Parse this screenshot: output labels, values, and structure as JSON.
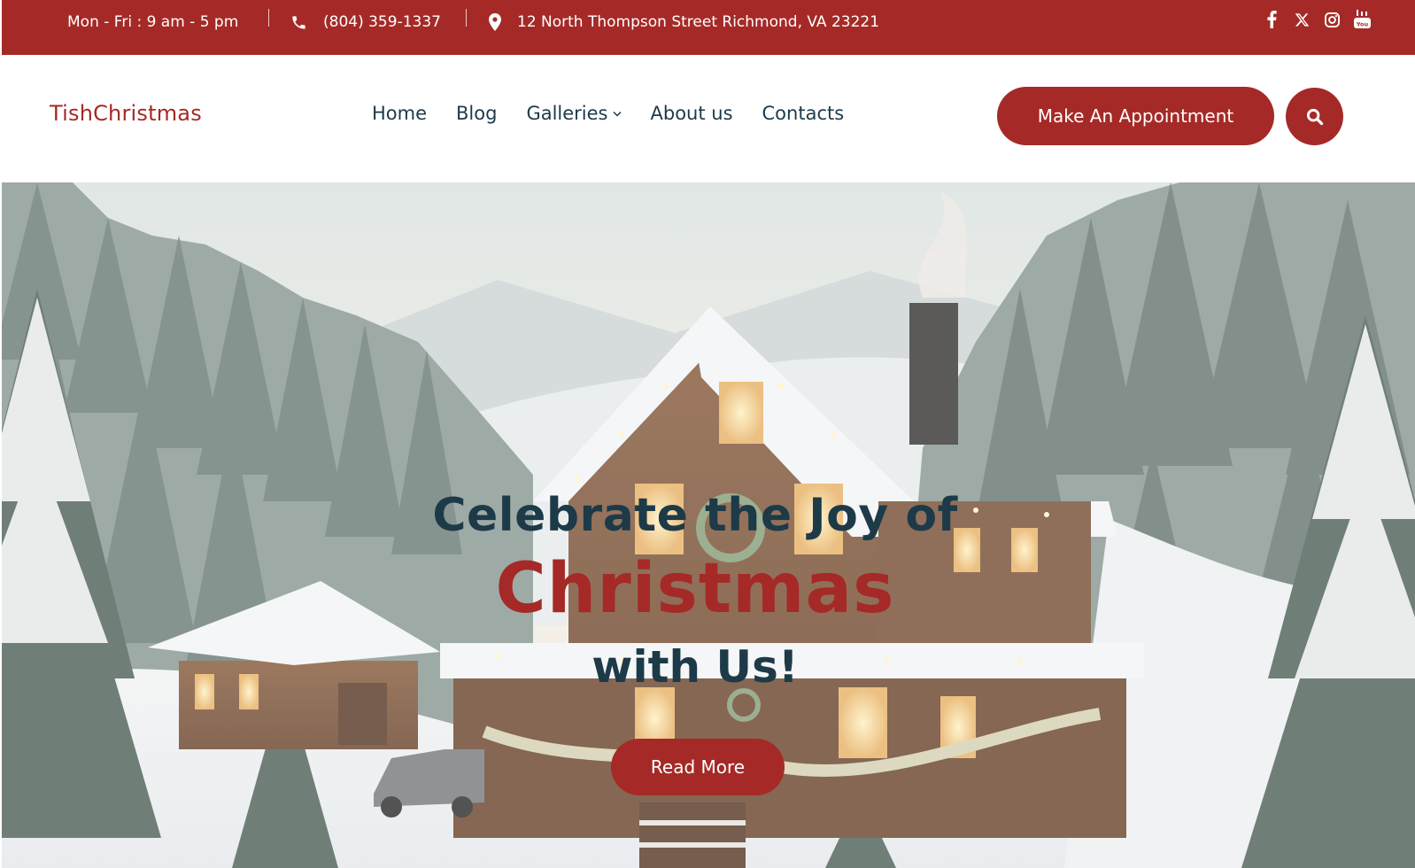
{
  "topbar": {
    "hours": "Mon - Fri : 9 am - 5 pm",
    "phone": "(804) 359-1337",
    "address": "12 North Thompson Street Richmond, VA 23221",
    "social_icons": [
      "facebook-icon",
      "x-twitter-icon",
      "instagram-icon",
      "youtube-icon"
    ]
  },
  "header": {
    "logo": "TishChristmas",
    "nav": [
      "Home",
      "Blog",
      "Galleries",
      "About us",
      "Contacts"
    ],
    "cta_label": "Make An Appointment"
  },
  "hero": {
    "line1": "Celebrate the Joy of",
    "line2": "Christmas",
    "line3": "with Us!",
    "button_label": "Read More"
  },
  "colors": {
    "brand_red": "#a52a27",
    "heading_navy": "#1d3a48",
    "nav_text": "#1c3a4a"
  }
}
